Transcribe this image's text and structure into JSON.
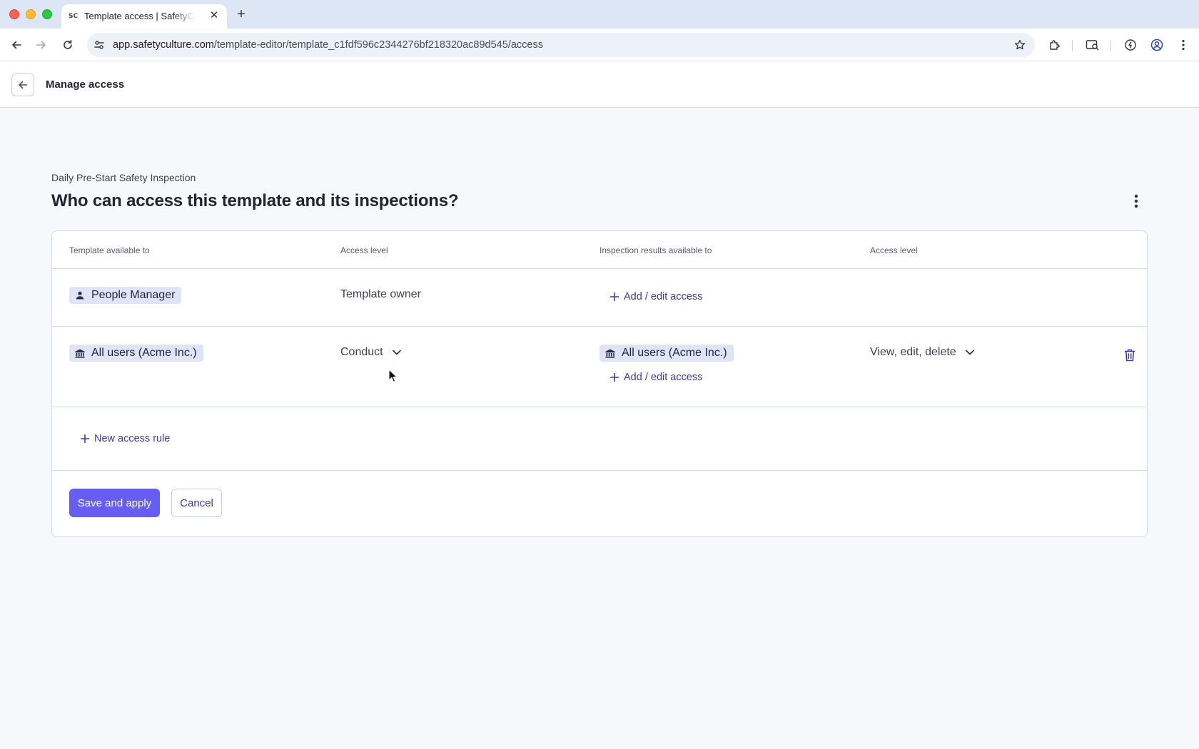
{
  "browser": {
    "tab_title": "Template access | SafetyCulture",
    "tab_favicon": "SC",
    "url_host": "app.safetyculture.com",
    "url_path": "/template-editor/template_c1fdf596c2344276bf218320ac89d545/access",
    "icons": [
      "back-arrow-icon",
      "forward-arrow-icon",
      "reload-icon",
      "site-settings-icon",
      "star-icon",
      "extensions-icon",
      "tab-search-icon",
      "performance-icon",
      "profile-icon",
      "kebab-menu-icon"
    ]
  },
  "header": {
    "title": "Manage access"
  },
  "page": {
    "template_name": "Daily Pre-Start Safety Inspection",
    "heading": "Who can access this template and its inspections?"
  },
  "table": {
    "columns": [
      "Template available to",
      "Access level",
      "Inspection results available to",
      "Access level"
    ],
    "rows": [
      {
        "template_available_to": "People Manager",
        "template_chip_icon": "person-icon",
        "access_level": "Template owner",
        "add_edit_label": "Add / edit access"
      },
      {
        "template_available_to": "All users (Acme Inc.)",
        "template_chip_icon": "organization-icon",
        "access_level": "Conduct",
        "results_available_to": "All users (Acme Inc.)",
        "results_access_level": "View, edit, delete",
        "add_edit_label": "Add / edit access"
      }
    ],
    "new_rule_label": "New access rule"
  },
  "actions": {
    "save_label": "Save and apply",
    "cancel_label": "Cancel"
  },
  "colors": {
    "accent": "#675df4",
    "link": "#3d3b9e",
    "chip_bg": "#e1e3f7",
    "page_bg": "#f7f8fc"
  }
}
